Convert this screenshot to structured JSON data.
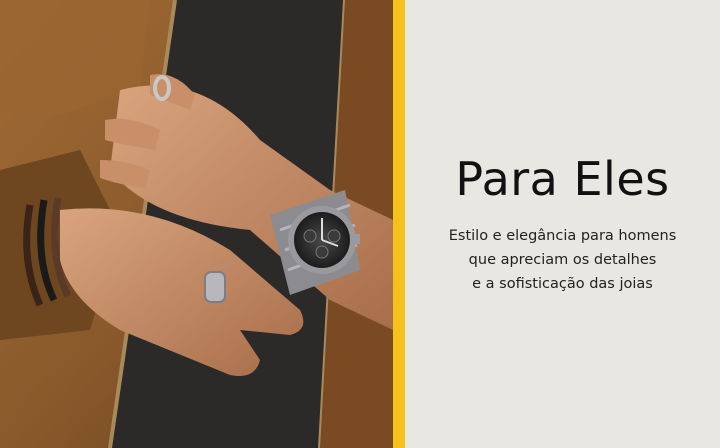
{
  "banner": {
    "title": "Para Eles",
    "subtitle_lines": [
      "Estilo e elegância para homens",
      "que apreciam os detalhes",
      "e a sofisticação das joias"
    ]
  },
  "colors": {
    "accent_stripe": "#f4c21a",
    "panel_background": "#e9e7e2",
    "jacket": "#8a5a2b",
    "shirt": "#2c2a28"
  },
  "image": {
    "depicts": "man-wearing-watch-and-rings-icon"
  }
}
